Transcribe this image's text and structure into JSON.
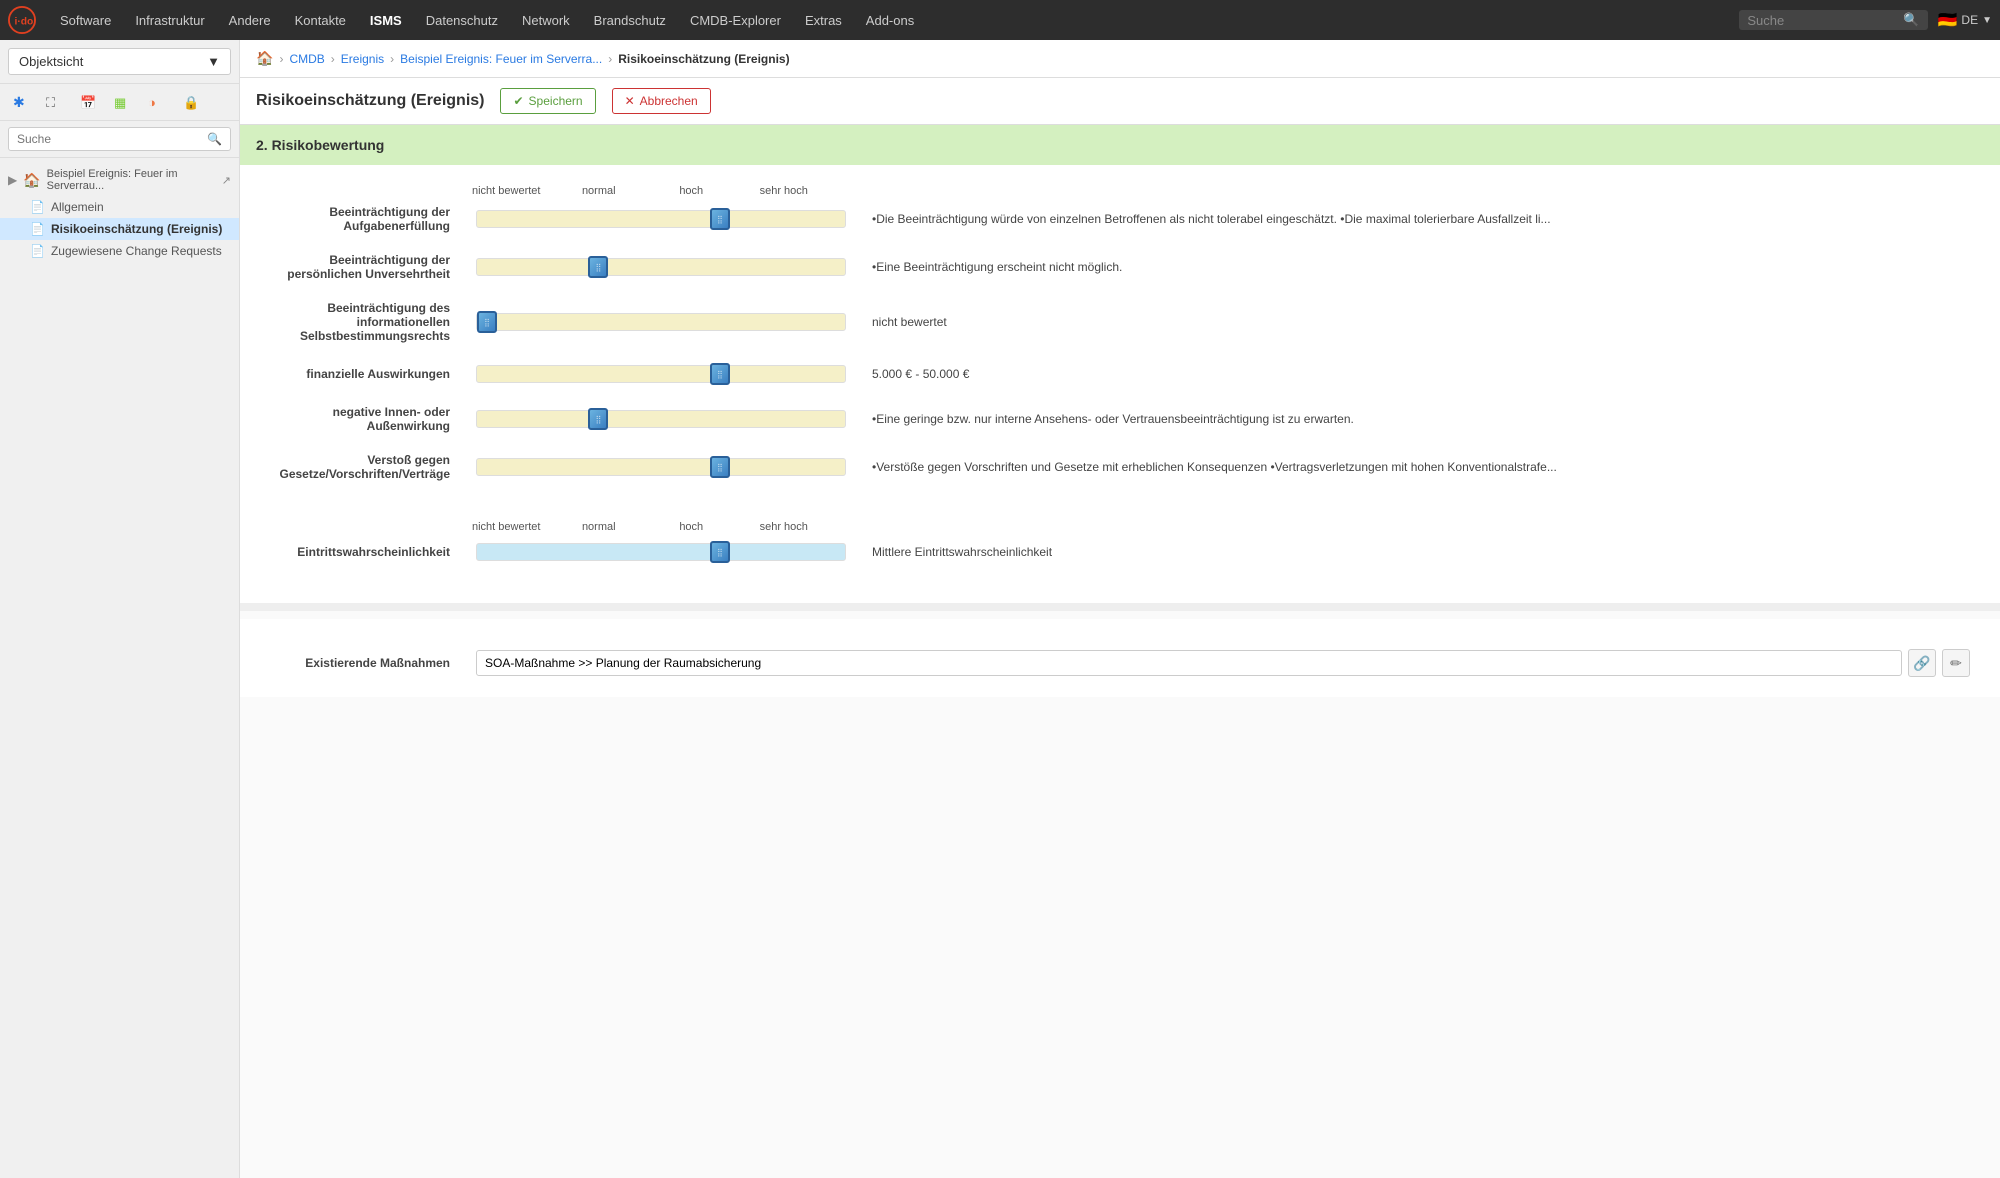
{
  "app": {
    "logo": "i-doit",
    "logo_symbol": "⚙"
  },
  "nav": {
    "items": [
      {
        "label": "Software",
        "active": false
      },
      {
        "label": "Infrastruktur",
        "active": false
      },
      {
        "label": "Andere",
        "active": false
      },
      {
        "label": "Kontakte",
        "active": false
      },
      {
        "label": "ISMS",
        "active": true
      },
      {
        "label": "Datenschutz",
        "active": false
      },
      {
        "label": "Network",
        "active": false
      },
      {
        "label": "Brandschutz",
        "active": false
      },
      {
        "label": "CMDB-Explorer",
        "active": false
      },
      {
        "label": "Extras",
        "active": false
      },
      {
        "label": "Add-ons",
        "active": false
      }
    ],
    "search_placeholder": "Suche",
    "language": "DE"
  },
  "sidebar": {
    "dropdown_label": "Objektsicht",
    "search_placeholder": "Suche",
    "tree_parent": "Beispiel Ereignis: Feuer im Serverrau...",
    "tree_items": [
      {
        "label": "Allgemein",
        "active": false
      },
      {
        "label": "Risikoeinschätzung (Ereignis)",
        "active": true
      },
      {
        "label": "Zugewiesene Change Requests",
        "active": false
      }
    ]
  },
  "breadcrumb": {
    "items": [
      {
        "label": "CMDB",
        "link": true
      },
      {
        "label": "Ereignis",
        "link": true
      },
      {
        "label": "Beispiel Ereignis: Feuer im Serverra...",
        "link": true
      },
      {
        "label": "Risikoeinschätzung (Ereignis)",
        "link": false
      }
    ]
  },
  "page": {
    "title": "Risikoeinschätzung (Ereignis)",
    "save_label": "Speichern",
    "cancel_label": "Abbrechen"
  },
  "section": {
    "title": "2. Risikobewertung"
  },
  "scale_labels": {
    "col1": "nicht bewertet",
    "col2": "normal",
    "col3": "hoch",
    "col4": "sehr hoch"
  },
  "sliders": [
    {
      "label": "Beeinträchtigung der\nAufgabenerfüllung",
      "label_line1": "Beeinträchtigung der",
      "label_line2": "Aufgabenerfüllung",
      "position": 66,
      "track": "yellow",
      "value_text": "•Die Beeinträchtigung würde von einzelnen Betroffenen als nicht tolerabel eingeschätzt. •Die maximal tolerierbare Ausfallzeit li..."
    },
    {
      "label": "Beeinträchtigung der\npersönlichen Unversehrtheit",
      "label_line1": "Beeinträchtigung der",
      "label_line2": "persönlichen Unversehrtheit",
      "position": 33,
      "track": "yellow",
      "value_text": "•Eine Beeinträchtigung erscheint nicht möglich."
    },
    {
      "label": "Beeinträchtigung des\ninformationellen\nSelbstbestimmungsrechts",
      "label_line1": "Beeinträchtigung des informationellen",
      "label_line2": "Selbstbestimmungsrechts",
      "position": 0,
      "track": "yellow",
      "value_text": "nicht bewertet"
    },
    {
      "label": "finanzielle Auswirkungen",
      "label_line1": "finanzielle Auswirkungen",
      "label_line2": "",
      "position": 66,
      "track": "yellow",
      "value_text": "5.000 € - 50.000 €"
    },
    {
      "label": "negative Innen- oder\nAußenwirkung",
      "label_line1": "negative Innen- oder",
      "label_line2": "Außenwirkung",
      "position": 33,
      "track": "yellow",
      "value_text": "•Eine geringe bzw. nur interne Ansehens- oder Vertrauensbeeinträchtigung ist zu erwarten."
    },
    {
      "label": "Verstoß gegen\nGesetze/Vorschriften/Verträge",
      "label_line1": "Verstoß gegen",
      "label_line2": "Gesetze/Vorschriften/Verträge",
      "position": 66,
      "track": "yellow",
      "value_text": "•Verstöße gegen Vorschriften und Gesetze mit erheblichen Konsequenzen •Vertragsverletzungen mit hohen Konventionalstrafe..."
    }
  ],
  "probability": {
    "label": "Eintrittswahrscheinlichkeit",
    "position": 66,
    "track": "blue",
    "value_text": "Mittlere Eintrittswahrscheinlichkeit"
  },
  "measures": {
    "label": "Existierende Maßnahmen",
    "value": "SOA-Maßnahme >> Planung der Raumabsicherung"
  }
}
